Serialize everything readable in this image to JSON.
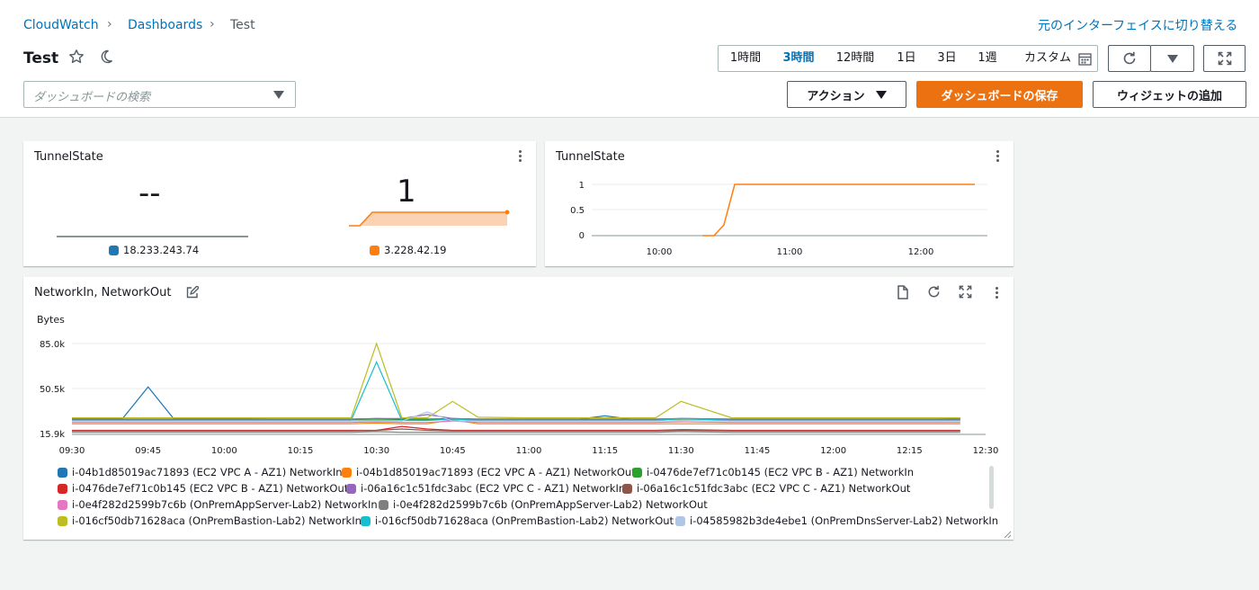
{
  "breadcrumb": {
    "root": "CloudWatch",
    "section": "Dashboards",
    "current": "Test"
  },
  "header": {
    "old_ui_link": "元のインターフェイスに切り替える",
    "title": "Test",
    "search_placeholder": "ダッシュボードの検索"
  },
  "time_range": {
    "options": [
      "1時間",
      "3時間",
      "12時間",
      "1日",
      "3日",
      "1週",
      "カスタム"
    ],
    "selected": "3時間"
  },
  "actions": {
    "actions_label": "アクション",
    "save_label": "ダッシュボードの保存",
    "add_widget_label": "ウィジェットの追加"
  },
  "widgets": {
    "tunnel_numbers": {
      "title": "TunnelState",
      "left": {
        "value": "--",
        "legend": "18.233.243.74",
        "color": "#1f77b4"
      },
      "right": {
        "value": "1",
        "legend": "3.228.42.19",
        "color": "#ff7f0e"
      }
    },
    "tunnel_line": {
      "title": "TunnelState",
      "y_ticks": [
        "1",
        "0.5",
        "0"
      ],
      "x_ticks": [
        "10:00",
        "11:00",
        "12:00"
      ]
    },
    "network": {
      "title": "NetworkIn, NetworkOut",
      "unit": "Bytes",
      "y_ticks": [
        "85.0k",
        "50.5k",
        "15.9k"
      ],
      "x_ticks": [
        "09:30",
        "09:45",
        "10:00",
        "10:15",
        "10:30",
        "10:45",
        "11:00",
        "11:15",
        "11:30",
        "11:45",
        "12:00",
        "12:15",
        "12:30"
      ],
      "legend": [
        {
          "label": "i-04b1d85019ac71893 (EC2 VPC A - AZ1) NetworkIn",
          "color": "#1f77b4"
        },
        {
          "label": "i-04b1d85019ac71893 (EC2 VPC A - AZ1) NetworkOut",
          "color": "#ff7f0e"
        },
        {
          "label": "i-0476de7ef71c0b145 (EC2 VPC B - AZ1) NetworkIn",
          "color": "#2ca02c"
        },
        {
          "label": "i-0476de7ef71c0b145 (EC2 VPC B - AZ1) NetworkOut",
          "color": "#d62728"
        },
        {
          "label": "i-06a16c1c51fdc3abc (EC2 VPC C - AZ1) NetworkIn",
          "color": "#9467bd"
        },
        {
          "label": "i-06a16c1c51fdc3abc (EC2 VPC C - AZ1) NetworkOut",
          "color": "#8c564b"
        },
        {
          "label": "i-0e4f282d2599b7c6b (OnPremAppServer-Lab2) NetworkIn",
          "color": "#e377c2"
        },
        {
          "label": "i-0e4f282d2599b7c6b (OnPremAppServer-Lab2) NetworkOut",
          "color": "#7f7f7f"
        },
        {
          "label": "i-016cf50db71628aca (OnPremBastion-Lab2) NetworkIn",
          "color": "#bcbd22"
        },
        {
          "label": "i-016cf50db71628aca (OnPremBastion-Lab2) NetworkOut",
          "color": "#17becf"
        },
        {
          "label": "i-04585982b3de4ebe1 (OnPremDnsServer-Lab2) NetworkIn",
          "color": "#aec7e8"
        }
      ]
    }
  },
  "chart_data": [
    {
      "type": "line",
      "title": "TunnelState",
      "x": [
        "10:00",
        "10:15",
        "10:25",
        "10:30",
        "10:35",
        "11:00",
        "11:30",
        "12:00",
        "12:25"
      ],
      "series": [
        {
          "name": "3.228.42.19",
          "values": [
            null,
            null,
            0,
            0.2,
            1,
            1,
            1,
            1,
            1
          ]
        }
      ],
      "ylim": [
        0,
        1
      ]
    },
    {
      "type": "line",
      "title": "NetworkIn, NetworkOut",
      "ylabel": "Bytes",
      "ylim": [
        15900,
        85000
      ],
      "x": [
        "09:30",
        "09:40",
        "09:45",
        "09:50",
        "10:00",
        "10:10",
        "10:20",
        "10:25",
        "10:30",
        "10:35",
        "10:40",
        "10:45",
        "10:50",
        "11:00",
        "11:10",
        "11:15",
        "11:20",
        "11:25",
        "11:30",
        "11:40",
        "11:50",
        "12:00",
        "12:10",
        "12:20",
        "12:25"
      ],
      "series": [
        {
          "name": "i-04b1d85019ac71893 (EC2 VPC A - AZ1) NetworkIn",
          "values": [
            28000,
            28000,
            52000,
            28000,
            28000,
            27500,
            27500,
            27500,
            28000,
            27500,
            27500,
            28000,
            27500,
            27500,
            27500,
            30000,
            27500,
            27500,
            28000,
            27500,
            27500,
            27500,
            27500,
            27500,
            28000
          ]
        },
        {
          "name": "i-04b1d85019ac71893 (EC2 VPC A - AZ1) NetworkOut",
          "values": [
            24000,
            24000,
            24000,
            24000,
            24000,
            24000,
            24000,
            24000,
            24500,
            24000,
            24000,
            27000,
            24000,
            24000,
            24000,
            24000,
            24000,
            24000,
            24000,
            24000,
            24000,
            24000,
            24000,
            24000,
            24000
          ]
        },
        {
          "name": "i-0476de7ef71c0b145 (EC2 VPC B - AZ1) NetworkIn",
          "values": [
            27000,
            27000,
            27000,
            27000,
            27000,
            27000,
            27000,
            27000,
            27000,
            27000,
            27000,
            28000,
            27000,
            27000,
            27000,
            27000,
            27000,
            27000,
            27500,
            27000,
            27000,
            27000,
            27000,
            27000,
            27000
          ]
        },
        {
          "name": "i-0476de7ef71c0b145 (EC2 VPC B - AZ1) NetworkOut",
          "values": [
            19000,
            19000,
            19000,
            19000,
            19000,
            19000,
            19000,
            19000,
            19000,
            22000,
            20000,
            19000,
            19000,
            19000,
            19000,
            19000,
            19000,
            19000,
            19500,
            19000,
            19000,
            19000,
            19000,
            19000,
            19000
          ]
        },
        {
          "name": "i-06a16c1c51fdc3abc (EC2 VPC C - AZ1) NetworkIn",
          "values": [
            27500,
            27500,
            27500,
            27500,
            27500,
            27500,
            27500,
            27500,
            28000,
            28000,
            31000,
            28000,
            27500,
            27500,
            27500,
            27500,
            27500,
            27500,
            28000,
            27500,
            27500,
            27500,
            27500,
            27500,
            27500
          ]
        },
        {
          "name": "i-06a16c1c51fdc3abc (EC2 VPC C - AZ1) NetworkOut",
          "values": [
            18500,
            18500,
            18500,
            18500,
            18500,
            18500,
            18500,
            18500,
            19000,
            20000,
            19000,
            18500,
            18500,
            18500,
            18500,
            18500,
            18500,
            18500,
            19000,
            18500,
            18500,
            18500,
            18500,
            18500,
            18500
          ]
        },
        {
          "name": "i-0e4f282d2599b7c6b (OnPremAppServer-Lab2) NetworkIn",
          "values": [
            25000,
            25000,
            25000,
            25000,
            25000,
            25000,
            25000,
            25000,
            25500,
            25000,
            25000,
            26000,
            25000,
            25000,
            25000,
            25000,
            25000,
            25000,
            25500,
            25000,
            25000,
            25000,
            25000,
            25000,
            25000
          ]
        },
        {
          "name": "i-0e4f282d2599b7c6b (OnPremAppServer-Lab2) NetworkOut",
          "values": [
            17500,
            17500,
            17500,
            17500,
            17500,
            17500,
            17500,
            17500,
            18000,
            17500,
            17500,
            17500,
            17500,
            17500,
            17500,
            17500,
            17500,
            17500,
            18000,
            17500,
            17500,
            17500,
            17500,
            17500,
            17500
          ]
        },
        {
          "name": "i-016cf50db71628aca (OnPremBastion-Lab2) NetworkIn",
          "values": [
            28500,
            28500,
            28500,
            28500,
            28500,
            28500,
            28500,
            28500,
            85000,
            28500,
            28500,
            41000,
            29000,
            28500,
            28500,
            28500,
            28500,
            28500,
            41000,
            28500,
            28500,
            28500,
            28500,
            28500,
            28500
          ]
        },
        {
          "name": "i-016cf50db71628aca (OnPremBastion-Lab2) NetworkOut",
          "values": [
            26500,
            26500,
            26500,
            26500,
            26500,
            26500,
            26500,
            26500,
            71000,
            26500,
            26500,
            27500,
            26500,
            26500,
            26500,
            26500,
            26500,
            26500,
            28000,
            26500,
            26500,
            26500,
            26500,
            26500,
            26500
          ]
        },
        {
          "name": "i-04585982b3de4ebe1 (OnPremDnsServer-Lab2) NetworkIn",
          "values": [
            26000,
            26000,
            26000,
            26000,
            26000,
            26000,
            26000,
            26000,
            26000,
            26000,
            33000,
            26000,
            26000,
            26000,
            26000,
            26000,
            26000,
            26000,
            26500,
            26000,
            26000,
            26000,
            26000,
            26000,
            26000
          ]
        }
      ]
    }
  ]
}
